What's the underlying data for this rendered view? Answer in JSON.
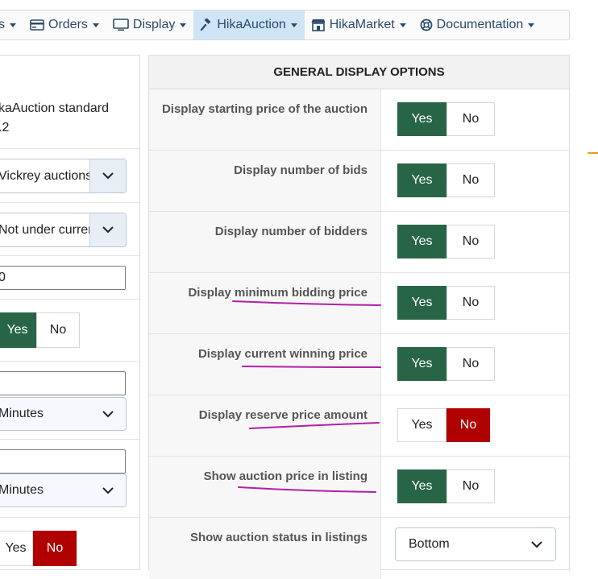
{
  "menu": {
    "items": [
      {
        "label": "s",
        "icon": "none"
      },
      {
        "label": "Orders",
        "icon": "credit-card-icon"
      },
      {
        "label": "Display",
        "icon": "monitor-icon"
      },
      {
        "label": "HikaAuction",
        "icon": "gavel-icon",
        "active": true
      },
      {
        "label": "HikaMarket",
        "icon": "store-icon"
      },
      {
        "label": "Documentation",
        "icon": "lifebuoy-icon"
      }
    ]
  },
  "left": {
    "row1_line1": "kaAuction standard",
    "row1_line2": ".2",
    "select_auction_type": "Vickrey auctions",
    "select_under_current": "Not under current",
    "input_value": "0",
    "toggle1": {
      "yes": "Yes",
      "no": "No",
      "selected": "yes"
    },
    "input_empty1": "",
    "select_minutes1": "Minutes",
    "input_empty2": "",
    "select_minutes2": "Minutes",
    "toggle2": {
      "yes": "Yes",
      "no": "No",
      "selected": "no"
    }
  },
  "general": {
    "header": "GENERAL DISPLAY OPTIONS",
    "options": [
      {
        "label": "Display starting price of the auction",
        "yes": "Yes",
        "no": "No",
        "selected": "yes"
      },
      {
        "label": "Display number of bids",
        "yes": "Yes",
        "no": "No",
        "selected": "yes"
      },
      {
        "label": "Display number of bidders",
        "yes": "Yes",
        "no": "No",
        "selected": "yes"
      },
      {
        "label": "Display minimum bidding price",
        "yes": "Yes",
        "no": "No",
        "selected": "yes"
      },
      {
        "label": "Display current winning price",
        "yes": "Yes",
        "no": "No",
        "selected": "yes"
      },
      {
        "label": "Display reserve price amount",
        "yes": "Yes",
        "no": "No",
        "selected": "no"
      },
      {
        "label": "Show auction price in listing",
        "yes": "Yes",
        "no": "No",
        "selected": "yes"
      }
    ],
    "status_label": "Show auction status in listings",
    "status_value": "Bottom"
  },
  "colors": {
    "yes_active": "#286546",
    "no_active": "#b00000",
    "annotation": "#b21fa8",
    "menu_active": "#cfe4f5"
  }
}
